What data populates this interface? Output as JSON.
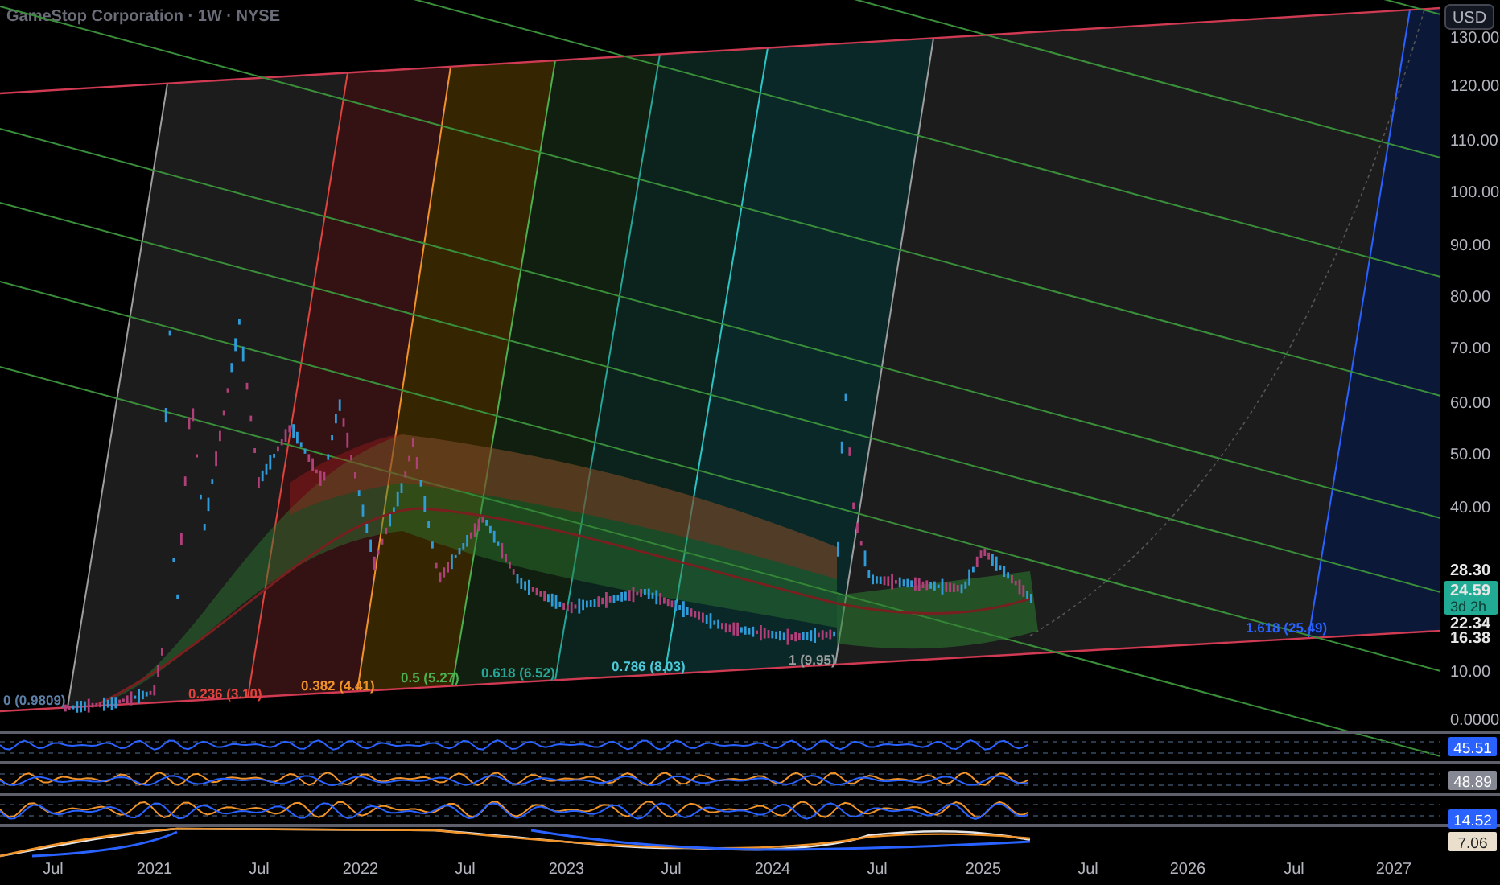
{
  "header": {
    "title": "GameStop Corporation · 1W · NYSE"
  },
  "price_axis": {
    "currency": "USD",
    "labels": [
      "130.00",
      "120.00",
      "110.00",
      "100.00",
      "90.00",
      "80.00",
      "70.00",
      "60.00",
      "50.00",
      "40.00",
      "10.00",
      "0.0000"
    ],
    "markers": [
      {
        "text": "28.30",
        "kind": "plain"
      },
      {
        "text": "24.59",
        "countdown": "3d 2h",
        "kind": "last"
      },
      {
        "text": "22.34",
        "kind": "plain"
      },
      {
        "text": "16.38",
        "kind": "plain"
      }
    ]
  },
  "fib_levels": [
    {
      "text": "0 (0.9809)",
      "color": "#5b7fa8"
    },
    {
      "text": "0.236 (3.10)",
      "color": "#e0443e"
    },
    {
      "text": "0.382 (4.41)",
      "color": "#f0932a"
    },
    {
      "text": "0.5 (5.27)",
      "color": "#4caf50"
    },
    {
      "text": "0.618 (6.52)",
      "color": "#26a69a"
    },
    {
      "text": "0.786 (8.03)",
      "color": "#4dc8d8"
    },
    {
      "text": "1 (9.95)",
      "color": "#9e9e9e"
    },
    {
      "text": "1.618 (25.49)",
      "color": "#2962ff"
    }
  ],
  "indicator_values": [
    {
      "text": "45.51",
      "color": "#2962ff"
    },
    {
      "text": "48.89",
      "color": "#868993"
    },
    {
      "text": "14.52",
      "color": "#2962ff"
    },
    {
      "text": "7.06",
      "color": "#e9dfcc"
    }
  ],
  "time_axis": [
    "Jul",
    "2021",
    "Jul",
    "2022",
    "Jul",
    "2023",
    "Jul",
    "2024",
    "Jul",
    "2025",
    "Jul",
    "2026",
    "Jul",
    "2027"
  ]
}
